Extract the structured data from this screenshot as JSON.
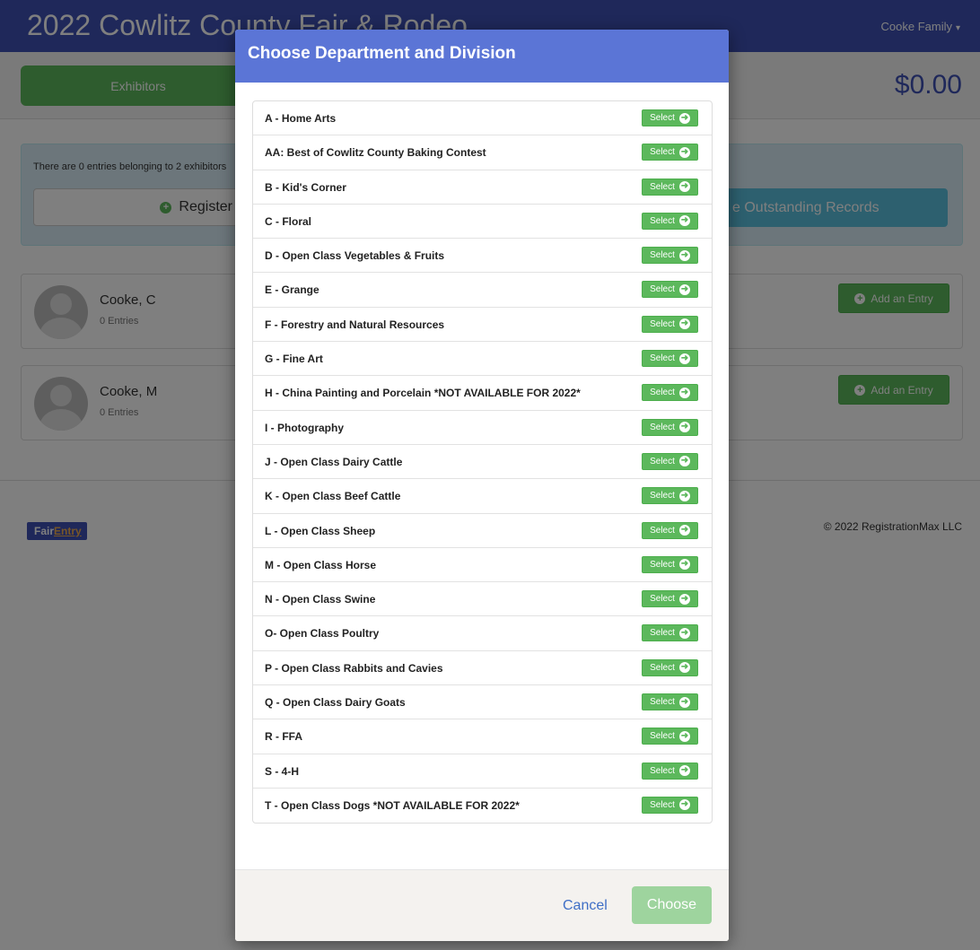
{
  "header": {
    "app_title": "2022 Cowlitz County Fair & Rodeo",
    "user_menu": "Cooke Family",
    "user_menu_caret": "▾"
  },
  "subbar": {
    "tab_exhibitors": "Exhibitors",
    "total": "$0.00"
  },
  "info": {
    "text": "There are 0 entries belonging to 2 exhibitors",
    "register_label": "Register",
    "outstanding_label": "e Outstanding Records"
  },
  "exhibitors": [
    {
      "name": "Cooke, C",
      "entries": "0 Entries",
      "add_label": "Add an Entry"
    },
    {
      "name": "Cooke, M",
      "entries": "0 Entries",
      "add_label": "Add an Entry"
    }
  ],
  "footer": {
    "logo_fair": "Fair",
    "logo_entry": "Entry",
    "copyright": "© 2022 RegistrationMax LLC"
  },
  "modal": {
    "title": "Choose Department and Division",
    "select_label": "Select",
    "departments": [
      "A - Home Arts",
      "AA: Best of Cowlitz County Baking Contest",
      "B - Kid's Corner",
      "C - Floral",
      "D - Open Class Vegetables & Fruits",
      "E - Grange",
      "F - Forestry and Natural Resources",
      "G - Fine Art",
      "H - China Painting and Porcelain *NOT AVAILABLE FOR 2022*",
      "I - Photography",
      "J - Open Class Dairy Cattle",
      "K - Open Class Beef Cattle",
      "L - Open Class Sheep",
      "M - Open Class Horse",
      "N - Open Class Swine",
      "O- Open Class Poultry",
      "P - Open Class Rabbits and Cavies",
      "Q - Open Class Dairy Goats",
      "R - FFA",
      "S - 4-H",
      "T - Open Class Dogs *NOT AVAILABLE FOR 2022*"
    ],
    "cancel_label": "Cancel",
    "choose_label": "Choose"
  },
  "colors": {
    "brand": "#3f51b5",
    "modal_header": "#5b75d6",
    "success": "#5cb85c",
    "info": "#5bc0de"
  },
  "icons": {
    "plus": "plus-circle-icon",
    "arrow": "arrow-right-circle-icon",
    "avatar": "user-silhouette-icon",
    "cursor": "mouse-pointer-icon"
  }
}
